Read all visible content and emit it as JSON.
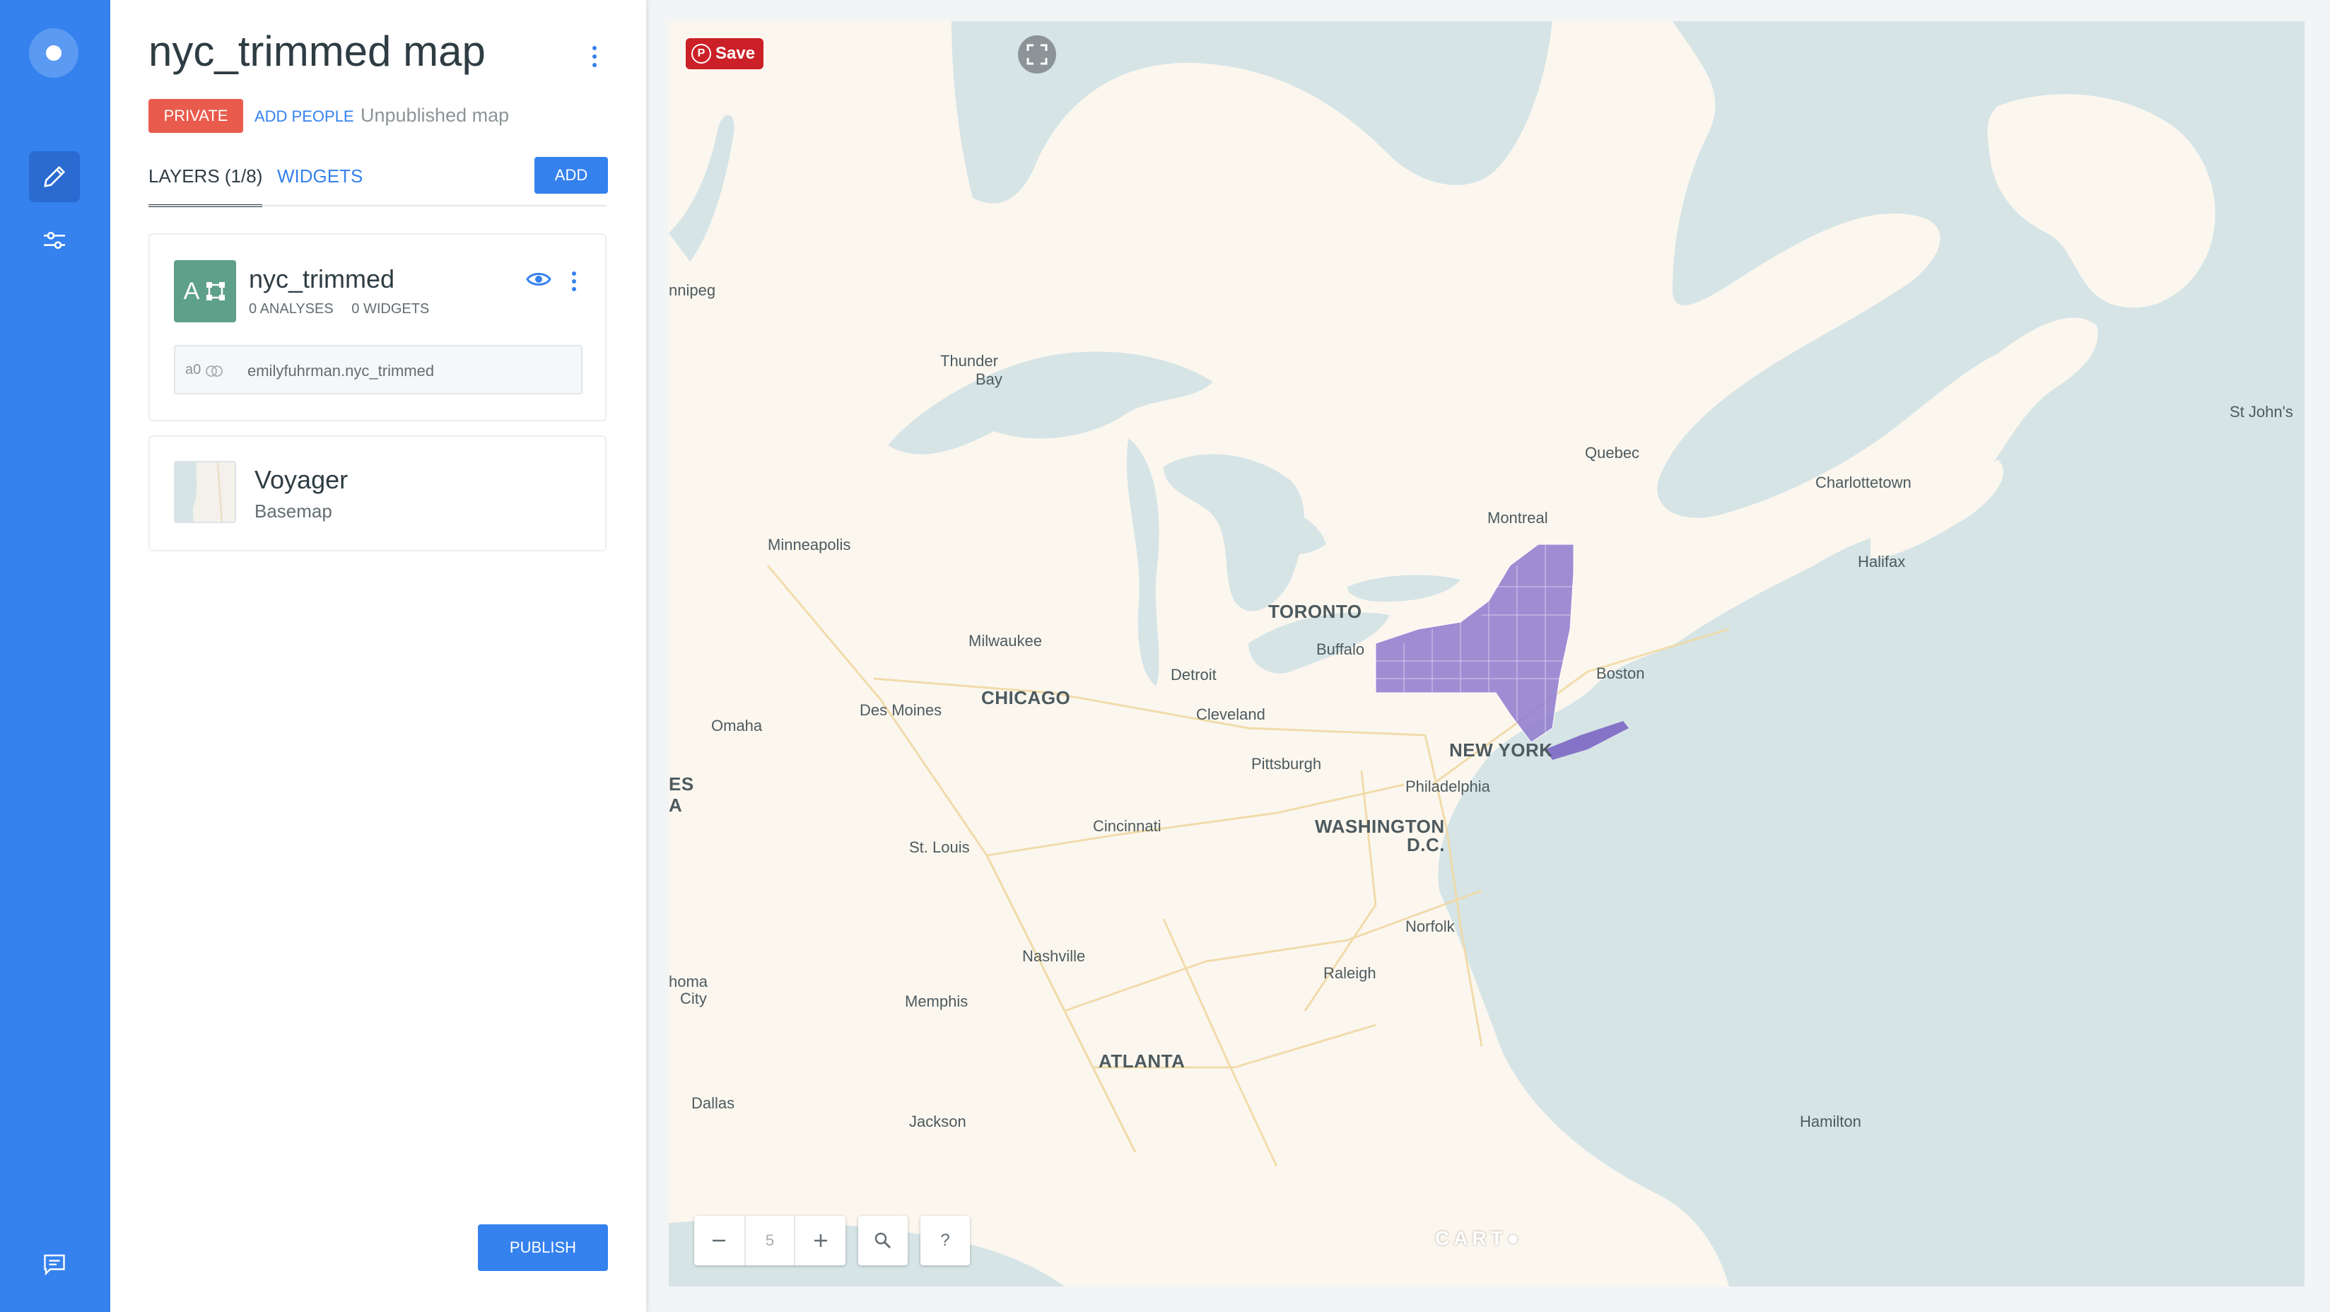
{
  "sidebar": {
    "items": [
      {
        "icon": "pencil-icon",
        "active": true
      },
      {
        "icon": "sliders-icon",
        "active": false
      }
    ],
    "bottom_icon": "chat-icon"
  },
  "panel": {
    "title": "nyc_trimmed map",
    "privacy": "PRIVATE",
    "add_people": "ADD PEOPLE",
    "publish_status": "Unpublished map",
    "tabs": [
      {
        "label": "LAYERS (1/8)",
        "active": true
      },
      {
        "label": "WIDGETS",
        "active": false
      }
    ],
    "add_label": "ADD",
    "layers": [
      {
        "letter": "A",
        "name": "nyc_trimmed",
        "analyses": "0 ANALYSES",
        "widgets": "0 WIDGETS",
        "source_id": "a0",
        "source_name": "emilyfuhrman.nyc_trimmed",
        "color": "#5ea089"
      }
    ],
    "basemap": {
      "name": "Voyager",
      "type": "Basemap"
    },
    "publish_label": "PUBLISH"
  },
  "map": {
    "pin_label": "Save",
    "zoom_level": "5",
    "help_label": "?",
    "attribution": "CART",
    "places": [
      {
        "name": "nnipeg",
        "big": false
      },
      {
        "name": "Thunder",
        "big": false
      },
      {
        "name": "Bay",
        "big": false
      },
      {
        "name": "Quebec",
        "big": false
      },
      {
        "name": "St John's",
        "big": false
      },
      {
        "name": "Charlottetown",
        "big": false
      },
      {
        "name": "Montreal",
        "big": false
      },
      {
        "name": "Halifax",
        "big": false
      },
      {
        "name": "Minneapolis",
        "big": false
      },
      {
        "name": "TORONTO",
        "big": true
      },
      {
        "name": "Buffalo",
        "big": false
      },
      {
        "name": "Milwaukee",
        "big": false
      },
      {
        "name": "Detroit",
        "big": false
      },
      {
        "name": "Boston",
        "big": false
      },
      {
        "name": "CHICAGO",
        "big": true
      },
      {
        "name": "Des Moines",
        "big": false
      },
      {
        "name": "Omaha",
        "big": false
      },
      {
        "name": "Cleveland",
        "big": false
      },
      {
        "name": "NEW YORK",
        "big": true
      },
      {
        "name": "Pittsburgh",
        "big": false
      },
      {
        "name": "Philadelphia",
        "big": false
      },
      {
        "name": "ES",
        "big": true
      },
      {
        "name": "A",
        "big": true
      },
      {
        "name": "WASHINGTON",
        "big": true
      },
      {
        "name": "D.C.",
        "big": true
      },
      {
        "name": "Cincinnati",
        "big": false
      },
      {
        "name": "St. Louis",
        "big": false
      },
      {
        "name": "Norfolk",
        "big": false
      },
      {
        "name": "Nashville",
        "big": false
      },
      {
        "name": "Raleigh",
        "big": false
      },
      {
        "name": "homa",
        "big": false
      },
      {
        "name": "City",
        "big": false
      },
      {
        "name": "Memphis",
        "big": false
      },
      {
        "name": "ATLANTA",
        "big": true
      },
      {
        "name": "Dallas",
        "big": false
      },
      {
        "name": "Jackson",
        "big": false
      },
      {
        "name": "Hamilton",
        "big": false
      }
    ],
    "colors": {
      "land": "#fbf7ef",
      "water": "#d6e4e6",
      "layer": "#8f7bcf",
      "pin": "#cb2027"
    }
  }
}
